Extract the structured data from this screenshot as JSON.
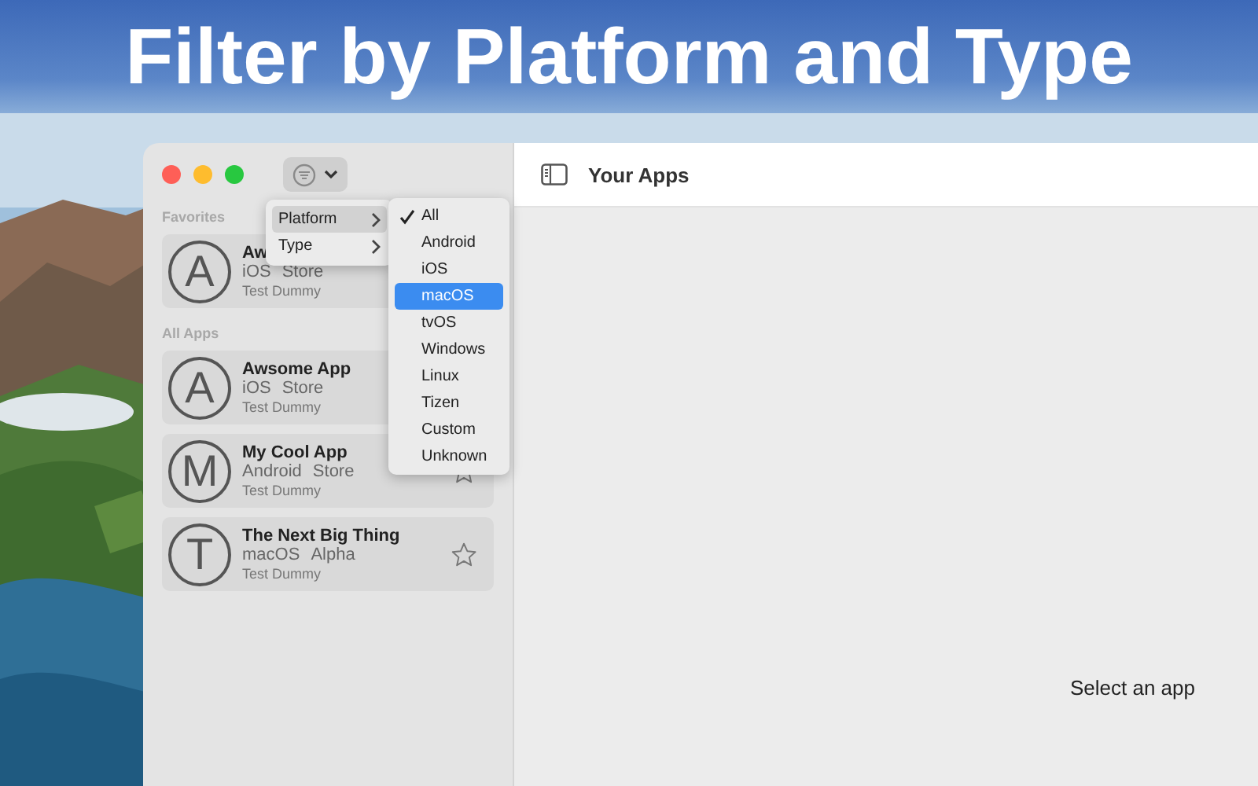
{
  "headline": "Filter by Platform and Type",
  "sidebar": {
    "sections": [
      {
        "title": "Favorites",
        "apps": [
          {
            "letter": "A",
            "name": "Aw",
            "platform": "iOS",
            "channel": "Store",
            "owner": "Test Dummy"
          }
        ]
      },
      {
        "title": "All Apps",
        "apps": [
          {
            "letter": "A",
            "name": "Awsome App",
            "platform": "iOS",
            "channel": "Store",
            "owner": "Test Dummy"
          },
          {
            "letter": "M",
            "name": "My Cool App",
            "platform": "Android",
            "channel": "Store",
            "owner": "Test Dummy",
            "star": true
          },
          {
            "letter": "T",
            "name": "The Next Big Thing",
            "platform": "macOS",
            "channel": "Alpha",
            "owner": "Test Dummy",
            "star": true
          }
        ]
      }
    ]
  },
  "filter_menu": {
    "items": [
      {
        "label": "Platform",
        "selected": true
      },
      {
        "label": "Type",
        "selected": false
      }
    ],
    "submenu": [
      {
        "label": "All",
        "checked": true,
        "selected": false
      },
      {
        "label": "Android",
        "checked": false,
        "selected": false
      },
      {
        "label": "iOS",
        "checked": false,
        "selected": false
      },
      {
        "label": "macOS",
        "checked": false,
        "selected": true
      },
      {
        "label": "tvOS",
        "checked": false,
        "selected": false
      },
      {
        "label": "Windows",
        "checked": false,
        "selected": false
      },
      {
        "label": "Linux",
        "checked": false,
        "selected": false
      },
      {
        "label": "Tizen",
        "checked": false,
        "selected": false
      },
      {
        "label": "Custom",
        "checked": false,
        "selected": false
      },
      {
        "label": "Unknown",
        "checked": false,
        "selected": false
      }
    ]
  },
  "toolbar": {
    "title": "Your Apps"
  },
  "detail": {
    "placeholder_text": "Select an app"
  }
}
